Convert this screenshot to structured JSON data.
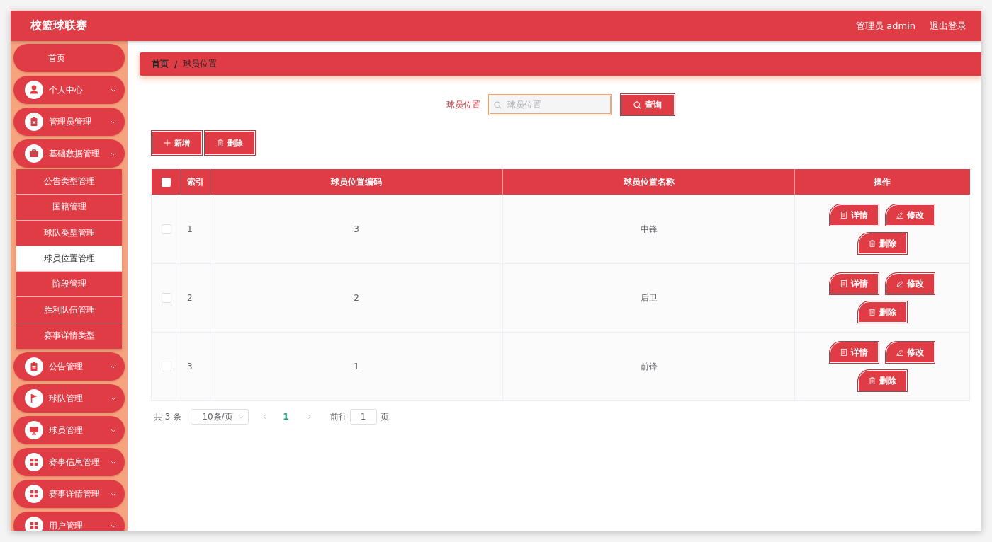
{
  "header": {
    "title": "校篮球联赛",
    "user": "管理员 admin",
    "logout": "退出登录"
  },
  "sidebar": {
    "items": [
      {
        "label": "首页",
        "kind": "link"
      },
      {
        "label": "个人中心",
        "kind": "menu"
      },
      {
        "label": "管理员管理",
        "kind": "menu"
      },
      {
        "label": "基础数据管理",
        "kind": "menu",
        "children": [
          {
            "label": "公告类型管理",
            "selected": false
          },
          {
            "label": "国籍管理",
            "selected": false
          },
          {
            "label": "球队类型管理",
            "selected": false
          },
          {
            "label": "球员位置管理",
            "selected": true
          },
          {
            "label": "阶段管理",
            "selected": false
          },
          {
            "label": "胜利队伍管理",
            "selected": false
          },
          {
            "label": "赛事详情类型",
            "selected": false
          }
        ]
      },
      {
        "label": "公告管理",
        "kind": "menu"
      },
      {
        "label": "球队管理",
        "kind": "menu"
      },
      {
        "label": "球员管理",
        "kind": "menu"
      },
      {
        "label": "赛事信息管理",
        "kind": "menu"
      },
      {
        "label": "赛事详情管理",
        "kind": "menu"
      },
      {
        "label": "用户管理",
        "kind": "menu"
      }
    ]
  },
  "breadcrumb": {
    "items": [
      "首页",
      "球员位置"
    ],
    "separator": "/"
  },
  "search": {
    "label": "球员位置",
    "placeholder": "球员位置",
    "button": "查询"
  },
  "toolbar": {
    "buttons": [
      {
        "label": "新增",
        "kind": "add"
      },
      {
        "label": "删除",
        "kind": "delete"
      }
    ]
  },
  "table": {
    "select_all_checked": false,
    "columns": [
      "索引",
      "球员位置编码",
      "球员位置名称",
      "操作"
    ],
    "rows": [
      {
        "checked": false,
        "cells": [
          "1",
          "3",
          "中锋"
        ],
        "actions": [
          {
            "label": "详情",
            "kind": "detail"
          },
          {
            "label": "修改",
            "kind": "edit"
          },
          {
            "label": "删除",
            "kind": "delete"
          }
        ]
      },
      {
        "checked": false,
        "cells": [
          "2",
          "2",
          "后卫"
        ],
        "actions": [
          {
            "label": "详情",
            "kind": "detail"
          },
          {
            "label": "修改",
            "kind": "edit"
          },
          {
            "label": "删除",
            "kind": "delete"
          }
        ]
      },
      {
        "checked": false,
        "cells": [
          "3",
          "1",
          "前锋"
        ],
        "actions": [
          {
            "label": "详情",
            "kind": "detail"
          },
          {
            "label": "修改",
            "kind": "edit"
          },
          {
            "label": "删除",
            "kind": "delete"
          }
        ]
      }
    ]
  },
  "pagination": {
    "total": "共 3 条",
    "page_size": "10条/页",
    "pages": [
      {
        "label": "1",
        "selected": true
      }
    ],
    "goto_label": "前往",
    "goto_value": "1",
    "goto_suffix": "页"
  }
}
